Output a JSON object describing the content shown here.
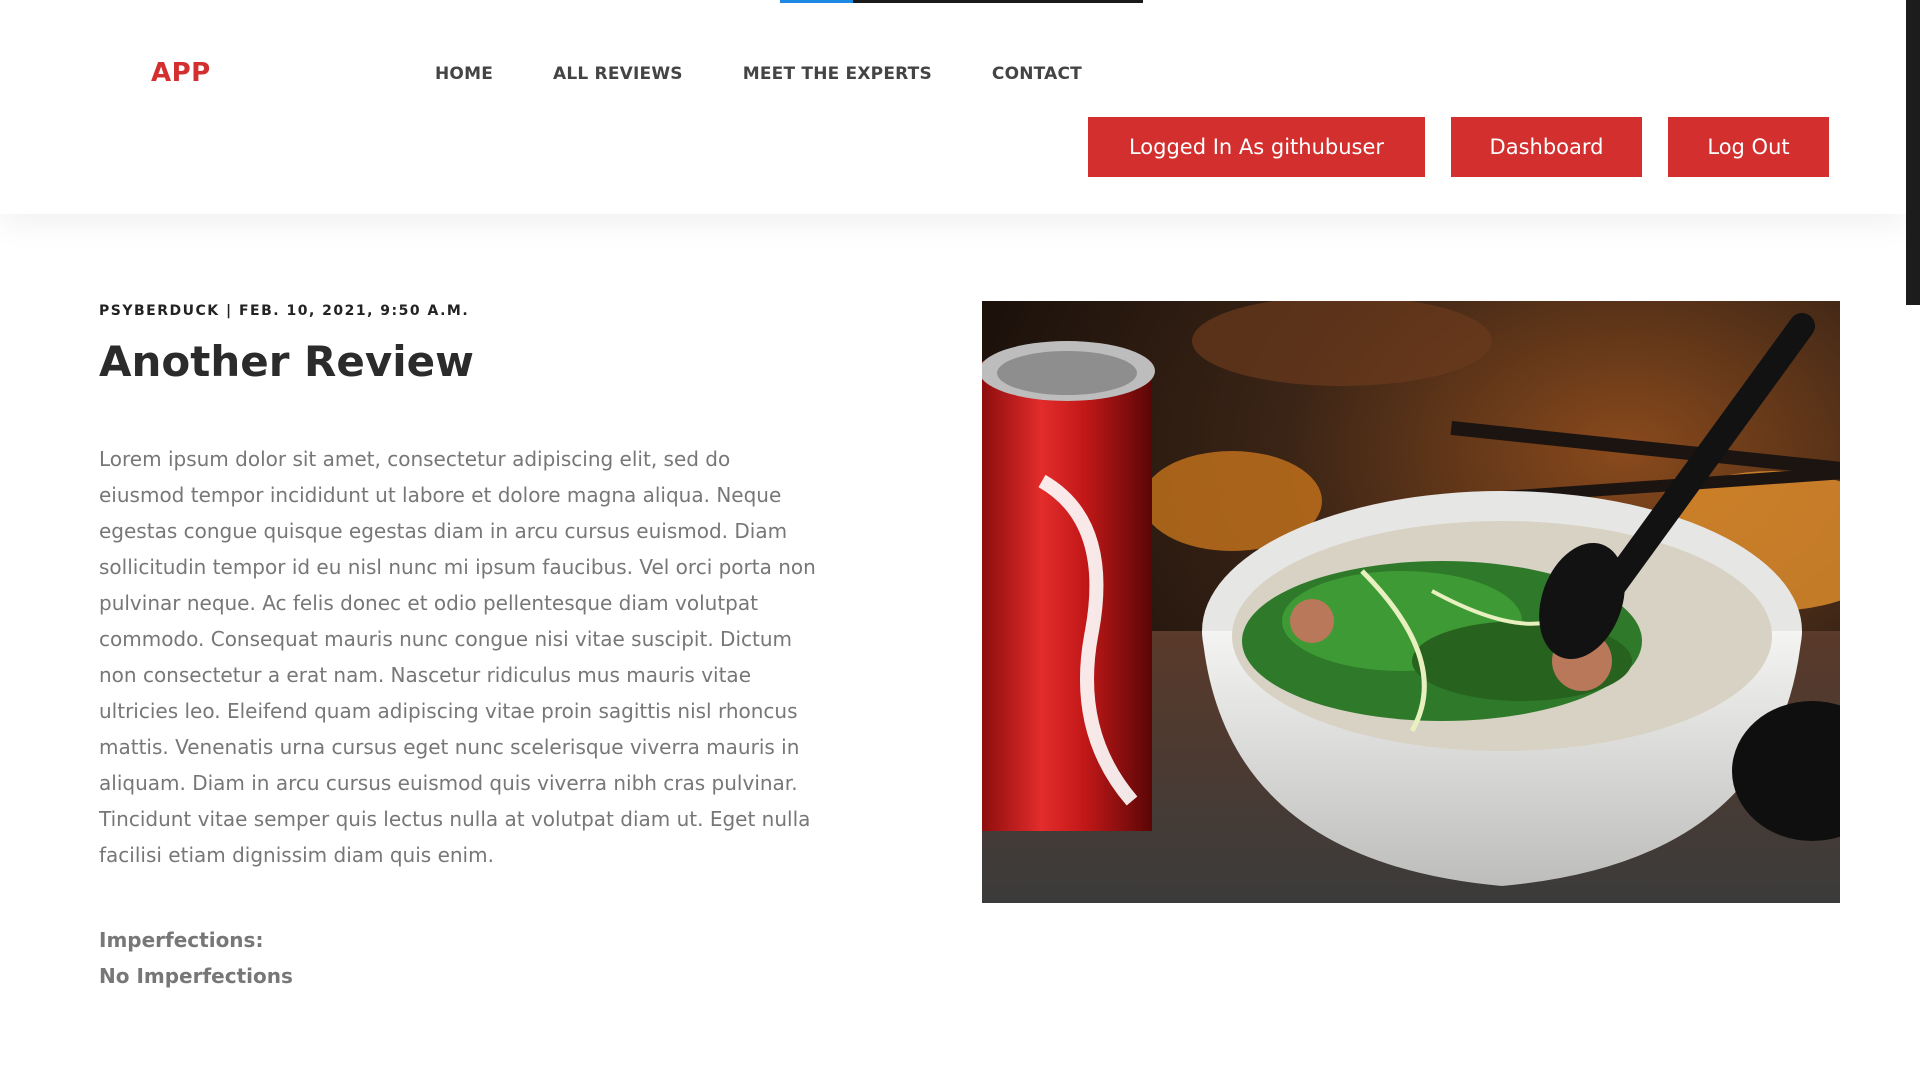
{
  "header": {
    "logo": "APP",
    "nav": [
      {
        "label": "HOME"
      },
      {
        "label": "ALL REVIEWS"
      },
      {
        "label": "MEET THE EXPERTS"
      },
      {
        "label": "CONTACT"
      }
    ],
    "buttons": {
      "user": "Logged In As githubuser",
      "dashboard": "Dashboard",
      "logout": "Log Out"
    }
  },
  "review": {
    "meta": "PSYBERDUCK | FEB. 10, 2021, 9:50 A.M.",
    "title": "Another Review",
    "body": "Lorem ipsum dolor sit amet, consectetur adipiscing elit, sed do eiusmod tempor incididunt ut labore et dolore magna aliqua. Neque egestas congue quisque egestas diam in arcu cursus euismod. Diam sollicitudin tempor id eu nisl nunc mi ipsum faucibus. Vel orci porta non pulvinar neque. Ac felis donec et odio pellentesque diam volutpat commodo. Consequat mauris nunc congue nisi vitae suscipit. Dictum non consectetur a erat nam. Nascetur ridiculus mus mauris vitae ultricies leo. Eleifend quam adipiscing vitae proin sagittis nisl rhoncus mattis. Venenatis urna cursus eget nunc scelerisque viverra mauris in aliquam. Diam in arcu cursus euismod quis viverra nibh cras pulvinar. Tincidunt vitae semper quis lectus nulla at volutpat diam ut. Eget nulla facilisi etiam dignissim diam quis enim.",
    "imperfections_label": "Imperfections:",
    "imperfections_value": "No Imperfections"
  },
  "colors": {
    "brand": "#d32f2f",
    "progress": "#1e88e5"
  },
  "page_load_progress": 0.2
}
